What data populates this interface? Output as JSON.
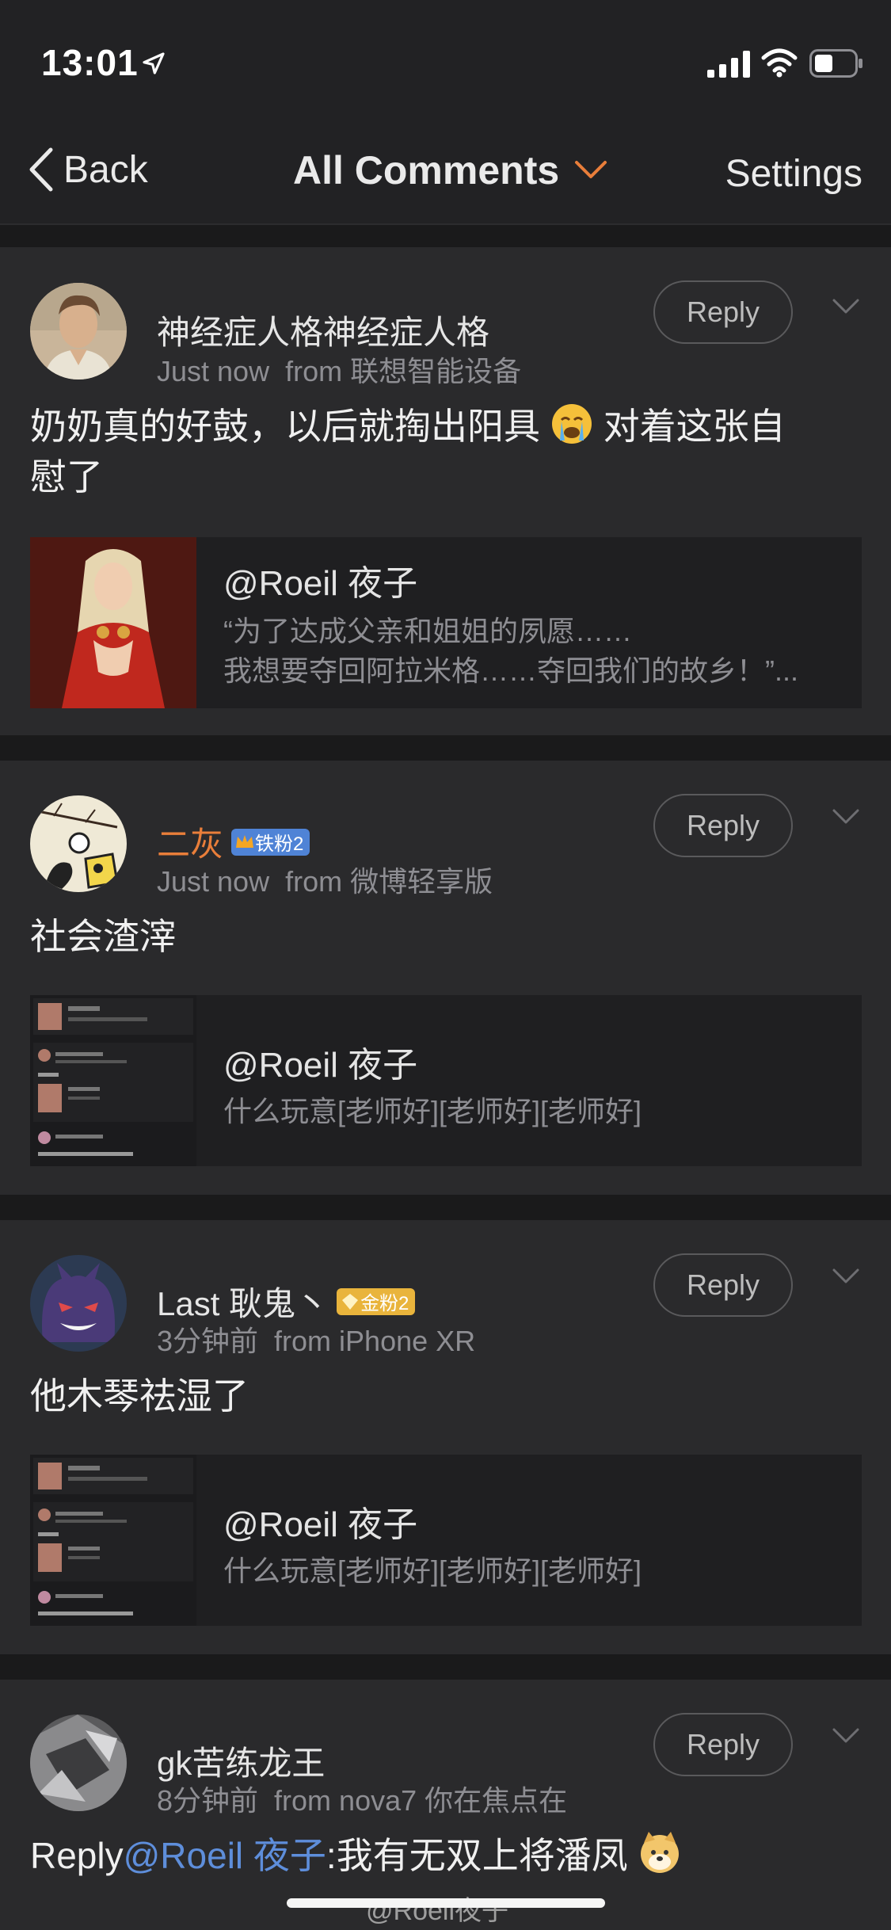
{
  "status_bar": {
    "time": "13:01"
  },
  "nav": {
    "back_label": "Back",
    "title": "All Comments",
    "settings_label": "Settings"
  },
  "comments": [
    {
      "username": "神经症人格神经症人格",
      "time": "Just now",
      "source": "from 联想智能设备",
      "reply_label": "Reply",
      "text_before": "奶奶真的好鼓，以后就掏出阳具",
      "text_after": "对着这张自",
      "text_line2": "慰了",
      "quote": {
        "name": "@Roeil 夜子",
        "line1": "“为了达成父亲和姐姐的夙愿……",
        "line2": "我想要夺回阿拉米格……夺回我们的故乡！”..."
      }
    },
    {
      "username": "二灰",
      "badge": "铁粉2",
      "time": "Just now",
      "source": "from 微博轻享版",
      "reply_label": "Reply",
      "text": "社会渣滓",
      "quote": {
        "name": "@Roeil 夜子",
        "line1": "什么玩意[老师好][老师好][老师好]"
      }
    },
    {
      "username": "Last 耿鬼丶",
      "badge": "金粉2",
      "time": "3分钟前",
      "source": "from iPhone XR",
      "reply_label": "Reply",
      "text": "他木琴祛湿了",
      "quote": {
        "name": "@Roeil 夜子",
        "line1": "什么玩意[老师好][老师好][老师好]"
      }
    },
    {
      "username": "gk苦练龙王",
      "time": "8分钟前",
      "source": "from nova7 你在焦点在",
      "reply_label": "Reply",
      "text_prefix": "Reply",
      "text_mention": "@Roeil 夜子",
      "text_rest": ":我有无双上将潘凤"
    }
  ],
  "watermark": "@Roeil夜子",
  "colors": {
    "background": "#222224",
    "card": "#2a2a2c",
    "accent_orange": "#e97e3a",
    "mention_blue": "#5e8edb"
  }
}
